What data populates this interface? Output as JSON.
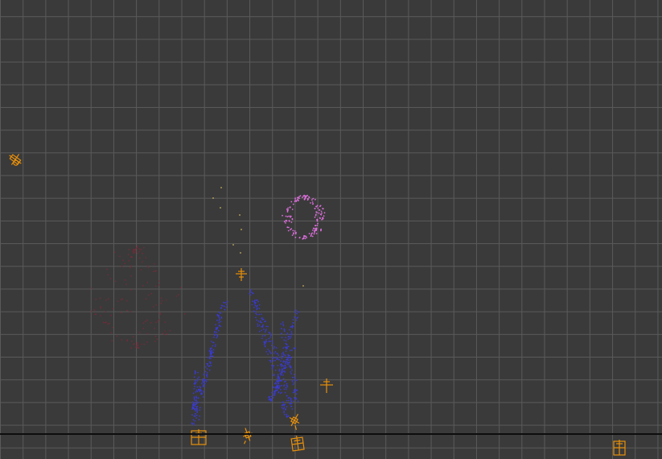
{
  "viewport": {
    "background": "#3a3a3a",
    "grid_color": "#5a5a5a",
    "floor_line_color": "#0d0d0d"
  },
  "colors": {
    "helper_orange": "#e8900a",
    "grass_particles": "#3a3acf",
    "sphere_particles": "#e070e0",
    "dim_sphere_particles": "#7a2a3a",
    "spark_particles": "#d8c060"
  },
  "objects": [
    {
      "id": "rotated-emitter-left",
      "icon": "emitter-icon"
    },
    {
      "id": "gizmo-center",
      "icon": "cross-gizmo-icon"
    },
    {
      "id": "gizmo-right",
      "icon": "cross-gizmo-icon"
    },
    {
      "id": "box-emitter-a",
      "icon": "box-emitter-icon"
    },
    {
      "id": "arrow-emitter-a",
      "icon": "arrow-emitter-icon"
    },
    {
      "id": "arrow-emitter-b",
      "icon": "arrow-emitter-icon"
    },
    {
      "id": "box-emitter-b",
      "icon": "box-emitter-icon"
    },
    {
      "id": "box-emitter-c",
      "icon": "box-emitter-icon"
    }
  ]
}
